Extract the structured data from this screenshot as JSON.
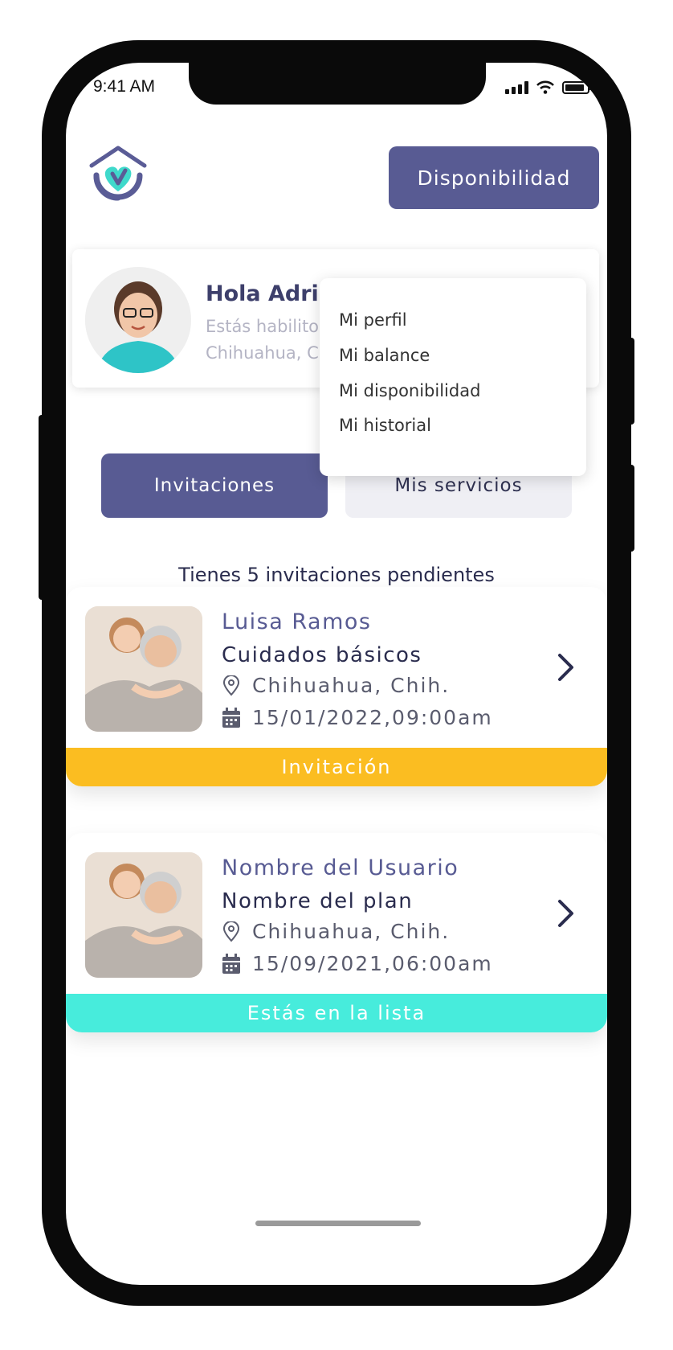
{
  "status_bar": {
    "time": "9:41 AM"
  },
  "header": {
    "availability_button": "Disponibilidad"
  },
  "profile": {
    "greeting": "Hola Adria",
    "line1": "Estás habilito",
    "line2": "Chihuahua, C"
  },
  "menu": {
    "items": [
      "Mi perfil",
      "Mi balance",
      "Mi disponibilidad",
      "Mi historial"
    ]
  },
  "tabs": [
    {
      "label": "Invitaciones",
      "active": true
    },
    {
      "label": "Mis servicios",
      "active": false
    }
  ],
  "pending_text": "Tienes 5 invitaciones pendientes",
  "cards": [
    {
      "name": "Luisa Ramos",
      "plan": "Cuidados básicos",
      "location": "Chihuahua, Chih.",
      "datetime": "15/01/2022,09:00am",
      "status": "Invitación",
      "status_color": "#fbbd21"
    },
    {
      "name": "Nombre del Usuario",
      "plan": "Nombre del plan",
      "location": "Chihuahua, Chih.",
      "datetime": "15/09/2021,06:00am",
      "status": "Estás en la lista",
      "status_color": "#47ecdc"
    }
  ],
  "colors": {
    "primary": "#585b93",
    "teal": "#47ecdc",
    "yellow": "#fbbd21"
  }
}
